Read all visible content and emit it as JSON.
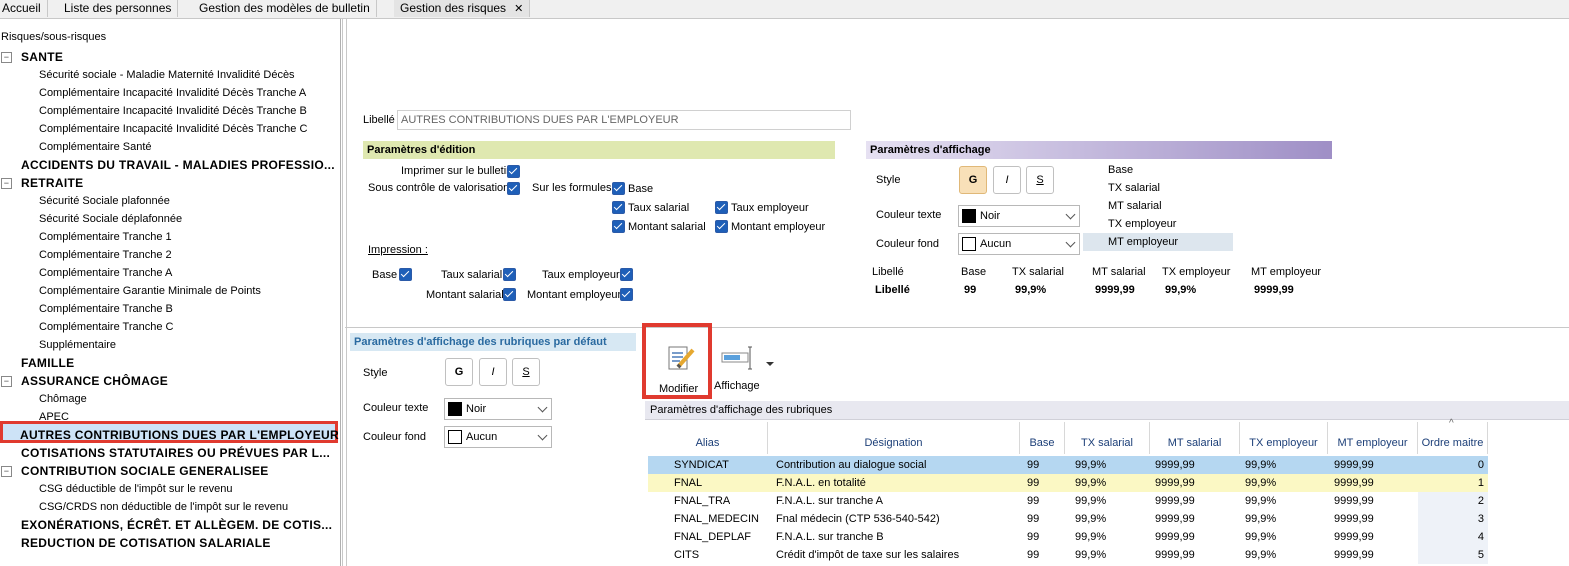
{
  "tabs": [
    {
      "label": "Accueil"
    },
    {
      "label": "Liste des personnes"
    },
    {
      "label": "Gestion des modèles de bulletin"
    },
    {
      "label": "Gestion des risques",
      "close": "✕"
    }
  ],
  "tree": {
    "header": "Risques/sous-risques",
    "items": [
      {
        "label": "SANTE",
        "cat": true,
        "toggle": "⊟"
      },
      {
        "label": "Sécurité sociale - Maladie Maternité Invalidité Décès"
      },
      {
        "label": "Complémentaire Incapacité Invalidité Décès Tranche A"
      },
      {
        "label": "Complémentaire Incapacité Invalidité Décès Tranche B"
      },
      {
        "label": "Complémentaire Incapacité Invalidité Décès Tranche C"
      },
      {
        "label": "Complémentaire Santé"
      },
      {
        "label": "ACCIDENTS DU TRAVAIL - MALADIES PROFESSIO...",
        "cat": true
      },
      {
        "label": "RETRAITE",
        "cat": true,
        "toggle": "⊟"
      },
      {
        "label": "Sécurité Sociale plafonnée"
      },
      {
        "label": "Sécurité Sociale déplafonnée"
      },
      {
        "label": "Complémentaire Tranche 1"
      },
      {
        "label": "Complémentaire Tranche 2"
      },
      {
        "label": "Complémentaire Tranche A"
      },
      {
        "label": "Complémentaire Garantie Minimale de Points"
      },
      {
        "label": "Complémentaire Tranche B"
      },
      {
        "label": "Complémentaire Tranche C"
      },
      {
        "label": "Supplémentaire"
      },
      {
        "label": "FAMILLE",
        "cat": true
      },
      {
        "label": "ASSURANCE CHÔMAGE",
        "cat": true,
        "toggle": "⊟"
      },
      {
        "label": "Chômage"
      },
      {
        "label": "APEC"
      },
      {
        "label": "AUTRES CONTRIBUTIONS DUES PAR L'EMPLOYEUR",
        "cat": true,
        "selected": true
      },
      {
        "label": "COTISATIONS STATUTAIRES OU PRÉVUES PAR L...",
        "cat": true
      },
      {
        "label": "CONTRIBUTION SOCIALE GENERALISEE",
        "cat": true,
        "toggle": "⊟"
      },
      {
        "label": "CSG déductible de l'impôt sur le revenu"
      },
      {
        "label": "CSG/CRDS non déductible de l'impôt sur le revenu"
      },
      {
        "label": "EXONÉRATIONS, ÉCRÊT. ET ALLÈGEM. DE COTIS...",
        "cat": true
      },
      {
        "label": "REDUCTION DE COTISATION SALARIALE",
        "cat": true
      }
    ]
  },
  "detail": {
    "libelle_label": "Libellé",
    "libelle_value": "AUTRES CONTRIBUTIONS DUES PAR L'EMPLOYEUR",
    "edition": {
      "header": "Paramètres d'édition",
      "imprimer": "Imprimer sur le bulletin",
      "sous_controle": "Sous contrôle de valorisation",
      "sur_formules": "Sur les formules",
      "base": "Base",
      "taux_salarial": "Taux salarial",
      "taux_employeur": "Taux employeur",
      "montant_salarial": "Montant salarial",
      "montant_employeur": "Montant employeur",
      "impression": "Impression :"
    },
    "affichage": {
      "header": "Paramètres d'affichage",
      "style": "Style",
      "bold": "G",
      "italic": "I",
      "underline": "S",
      "couleur_texte": "Couleur texte",
      "couleur_texte_value": "Noir",
      "couleur_fond": "Couleur fond",
      "couleur_fond_value": "Aucun",
      "list": [
        "Base",
        "TX salarial",
        "MT salarial",
        "TX employeur",
        "MT employeur"
      ],
      "preview_headers": [
        "Libellé",
        "Base",
        "TX salarial",
        "MT salarial",
        "TX employeur",
        "MT employeur"
      ],
      "preview_values": [
        "Libellé",
        "99",
        "99,9%",
        "9999,99",
        "99,9%",
        "9999,99"
      ]
    },
    "defaut": {
      "header": "Paramètres d'affichage des rubriques par défaut",
      "style": "Style",
      "bold": "G",
      "italic": "I",
      "underline": "S",
      "couleur_texte": "Couleur texte",
      "couleur_texte_value": "Noir",
      "couleur_fond": "Couleur fond",
      "couleur_fond_value": "Aucun"
    }
  },
  "toolbar": {
    "modifier": "Modifier",
    "affichage": "Affichage"
  },
  "grid": {
    "title": "Paramètres d'affichage des rubriques",
    "sort_indicator": "^",
    "columns": [
      "Alias",
      "Désignation",
      "Base",
      "TX salarial",
      "MT salarial",
      "TX employeur",
      "MT employeur",
      "Ordre maitre"
    ],
    "rows": [
      [
        "SYNDICAT",
        "Contribution au dialogue social",
        "99",
        "99,9%",
        "9999,99",
        "99,9%",
        "9999,99",
        "0"
      ],
      [
        "FNAL",
        "F.N.A.L. en totalité",
        "99",
        "99,9%",
        "9999,99",
        "99,9%",
        "9999,99",
        "1"
      ],
      [
        "FNAL_TRA",
        "F.N.A.L. sur tranche A",
        "99",
        "99,9%",
        "9999,99",
        "99,9%",
        "9999,99",
        "2"
      ],
      [
        "FNAL_MEDECIN",
        "Fnal médecin (CTP 536-540-542)",
        "99",
        "99,9%",
        "9999,99",
        "99,9%",
        "9999,99",
        "3"
      ],
      [
        "FNAL_DEPLAF",
        "F.N.A.L. sur tranche B",
        "99",
        "99,9%",
        "9999,99",
        "99,9%",
        "9999,99",
        "4"
      ],
      [
        "CITS",
        "Crédit d'impôt de taxe sur les salaires",
        "99",
        "99,9%",
        "9999,99",
        "99,9%",
        "9999,99",
        "5"
      ]
    ]
  },
  "colors": {
    "highlight_red": "#e03a2f",
    "edition_header": "#dfe8b0",
    "affichage_header": "#9f8fc6",
    "defaut_header": "#d7e8f3",
    "row_selected": "#b5d7f1",
    "row_yellow": "#fbf8c4"
  }
}
